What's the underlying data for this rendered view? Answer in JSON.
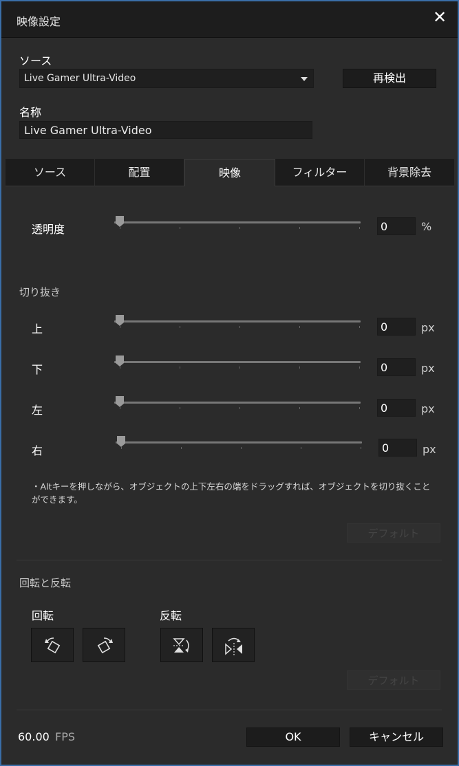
{
  "window": {
    "title": "映像設定",
    "close_glyph": "✕"
  },
  "source": {
    "label": "ソース",
    "selected": "Live Gamer Ultra-Video",
    "redetect_label": "再検出"
  },
  "name": {
    "label": "名称",
    "value": "Live Gamer Ultra-Video"
  },
  "tabs": [
    {
      "label": "ソース"
    },
    {
      "label": "配置"
    },
    {
      "label": "映像",
      "active": true
    },
    {
      "label": "フィルター"
    },
    {
      "label": "背景除去"
    }
  ],
  "opacity": {
    "label": "透明度",
    "value": "0",
    "unit": "%"
  },
  "crop": {
    "section_label": "切り抜き",
    "rows": [
      {
        "label": "上",
        "value": "0",
        "unit": "px"
      },
      {
        "label": "下",
        "value": "0",
        "unit": "px"
      },
      {
        "label": "左",
        "value": "0",
        "unit": "px"
      },
      {
        "label": "右",
        "value": "0",
        "unit": "px"
      }
    ],
    "note": "・Altキーを押しながら、オブジェクトの上下左右の端をドラッグすれば、オブジェクトを切り抜くことができます。",
    "default_label": "デフォルト"
  },
  "transform": {
    "section_label": "回転と反転",
    "rotate_label": "回転",
    "flip_label": "反転",
    "default_label": "デフォルト",
    "icons": [
      "rotate-left-icon",
      "rotate-right-icon",
      "flip-vertical-icon",
      "flip-horizontal-icon"
    ]
  },
  "footer": {
    "fps_value": "60.00",
    "fps_label": "FPS",
    "ok_label": "OK",
    "cancel_label": "キャンセル"
  },
  "colors": {
    "accent_border": "#3a6ea8",
    "background": "#2b2b2b",
    "titlebar": "#1d1d1d"
  }
}
